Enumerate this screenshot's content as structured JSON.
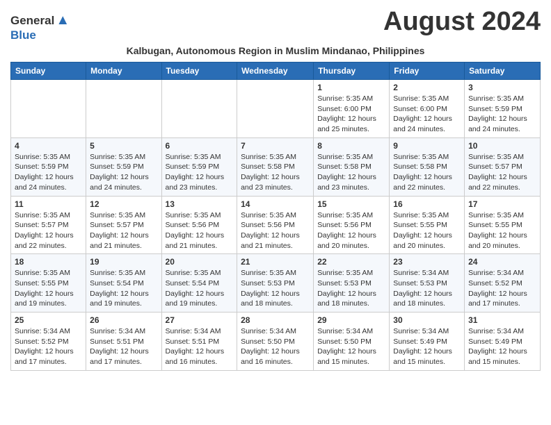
{
  "logo": {
    "general": "General",
    "blue": "Blue"
  },
  "title": "August 2024",
  "subtitle": "Kalbugan, Autonomous Region in Muslim Mindanao, Philippines",
  "header_days": [
    "Sunday",
    "Monday",
    "Tuesday",
    "Wednesday",
    "Thursday",
    "Friday",
    "Saturday"
  ],
  "weeks": [
    [
      {
        "day": "",
        "sunrise": "",
        "sunset": "",
        "daylight": ""
      },
      {
        "day": "",
        "sunrise": "",
        "sunset": "",
        "daylight": ""
      },
      {
        "day": "",
        "sunrise": "",
        "sunset": "",
        "daylight": ""
      },
      {
        "day": "",
        "sunrise": "",
        "sunset": "",
        "daylight": ""
      },
      {
        "day": "1",
        "sunrise": "5:35 AM",
        "sunset": "6:00 PM",
        "daylight": "12 hours and 25 minutes."
      },
      {
        "day": "2",
        "sunrise": "5:35 AM",
        "sunset": "6:00 PM",
        "daylight": "12 hours and 24 minutes."
      },
      {
        "day": "3",
        "sunrise": "5:35 AM",
        "sunset": "5:59 PM",
        "daylight": "12 hours and 24 minutes."
      }
    ],
    [
      {
        "day": "4",
        "sunrise": "5:35 AM",
        "sunset": "5:59 PM",
        "daylight": "12 hours and 24 minutes."
      },
      {
        "day": "5",
        "sunrise": "5:35 AM",
        "sunset": "5:59 PM",
        "daylight": "12 hours and 24 minutes."
      },
      {
        "day": "6",
        "sunrise": "5:35 AM",
        "sunset": "5:59 PM",
        "daylight": "12 hours and 23 minutes."
      },
      {
        "day": "7",
        "sunrise": "5:35 AM",
        "sunset": "5:58 PM",
        "daylight": "12 hours and 23 minutes."
      },
      {
        "day": "8",
        "sunrise": "5:35 AM",
        "sunset": "5:58 PM",
        "daylight": "12 hours and 23 minutes."
      },
      {
        "day": "9",
        "sunrise": "5:35 AM",
        "sunset": "5:58 PM",
        "daylight": "12 hours and 22 minutes."
      },
      {
        "day": "10",
        "sunrise": "5:35 AM",
        "sunset": "5:57 PM",
        "daylight": "12 hours and 22 minutes."
      }
    ],
    [
      {
        "day": "11",
        "sunrise": "5:35 AM",
        "sunset": "5:57 PM",
        "daylight": "12 hours and 22 minutes."
      },
      {
        "day": "12",
        "sunrise": "5:35 AM",
        "sunset": "5:57 PM",
        "daylight": "12 hours and 21 minutes."
      },
      {
        "day": "13",
        "sunrise": "5:35 AM",
        "sunset": "5:56 PM",
        "daylight": "12 hours and 21 minutes."
      },
      {
        "day": "14",
        "sunrise": "5:35 AM",
        "sunset": "5:56 PM",
        "daylight": "12 hours and 21 minutes."
      },
      {
        "day": "15",
        "sunrise": "5:35 AM",
        "sunset": "5:56 PM",
        "daylight": "12 hours and 20 minutes."
      },
      {
        "day": "16",
        "sunrise": "5:35 AM",
        "sunset": "5:55 PM",
        "daylight": "12 hours and 20 minutes."
      },
      {
        "day": "17",
        "sunrise": "5:35 AM",
        "sunset": "5:55 PM",
        "daylight": "12 hours and 20 minutes."
      }
    ],
    [
      {
        "day": "18",
        "sunrise": "5:35 AM",
        "sunset": "5:55 PM",
        "daylight": "12 hours and 19 minutes."
      },
      {
        "day": "19",
        "sunrise": "5:35 AM",
        "sunset": "5:54 PM",
        "daylight": "12 hours and 19 minutes."
      },
      {
        "day": "20",
        "sunrise": "5:35 AM",
        "sunset": "5:54 PM",
        "daylight": "12 hours and 19 minutes."
      },
      {
        "day": "21",
        "sunrise": "5:35 AM",
        "sunset": "5:53 PM",
        "daylight": "12 hours and 18 minutes."
      },
      {
        "day": "22",
        "sunrise": "5:35 AM",
        "sunset": "5:53 PM",
        "daylight": "12 hours and 18 minutes."
      },
      {
        "day": "23",
        "sunrise": "5:34 AM",
        "sunset": "5:53 PM",
        "daylight": "12 hours and 18 minutes."
      },
      {
        "day": "24",
        "sunrise": "5:34 AM",
        "sunset": "5:52 PM",
        "daylight": "12 hours and 17 minutes."
      }
    ],
    [
      {
        "day": "25",
        "sunrise": "5:34 AM",
        "sunset": "5:52 PM",
        "daylight": "12 hours and 17 minutes."
      },
      {
        "day": "26",
        "sunrise": "5:34 AM",
        "sunset": "5:51 PM",
        "daylight": "12 hours and 17 minutes."
      },
      {
        "day": "27",
        "sunrise": "5:34 AM",
        "sunset": "5:51 PM",
        "daylight": "12 hours and 16 minutes."
      },
      {
        "day": "28",
        "sunrise": "5:34 AM",
        "sunset": "5:50 PM",
        "daylight": "12 hours and 16 minutes."
      },
      {
        "day": "29",
        "sunrise": "5:34 AM",
        "sunset": "5:50 PM",
        "daylight": "12 hours and 15 minutes."
      },
      {
        "day": "30",
        "sunrise": "5:34 AM",
        "sunset": "5:49 PM",
        "daylight": "12 hours and 15 minutes."
      },
      {
        "day": "31",
        "sunrise": "5:34 AM",
        "sunset": "5:49 PM",
        "daylight": "12 hours and 15 minutes."
      }
    ]
  ]
}
